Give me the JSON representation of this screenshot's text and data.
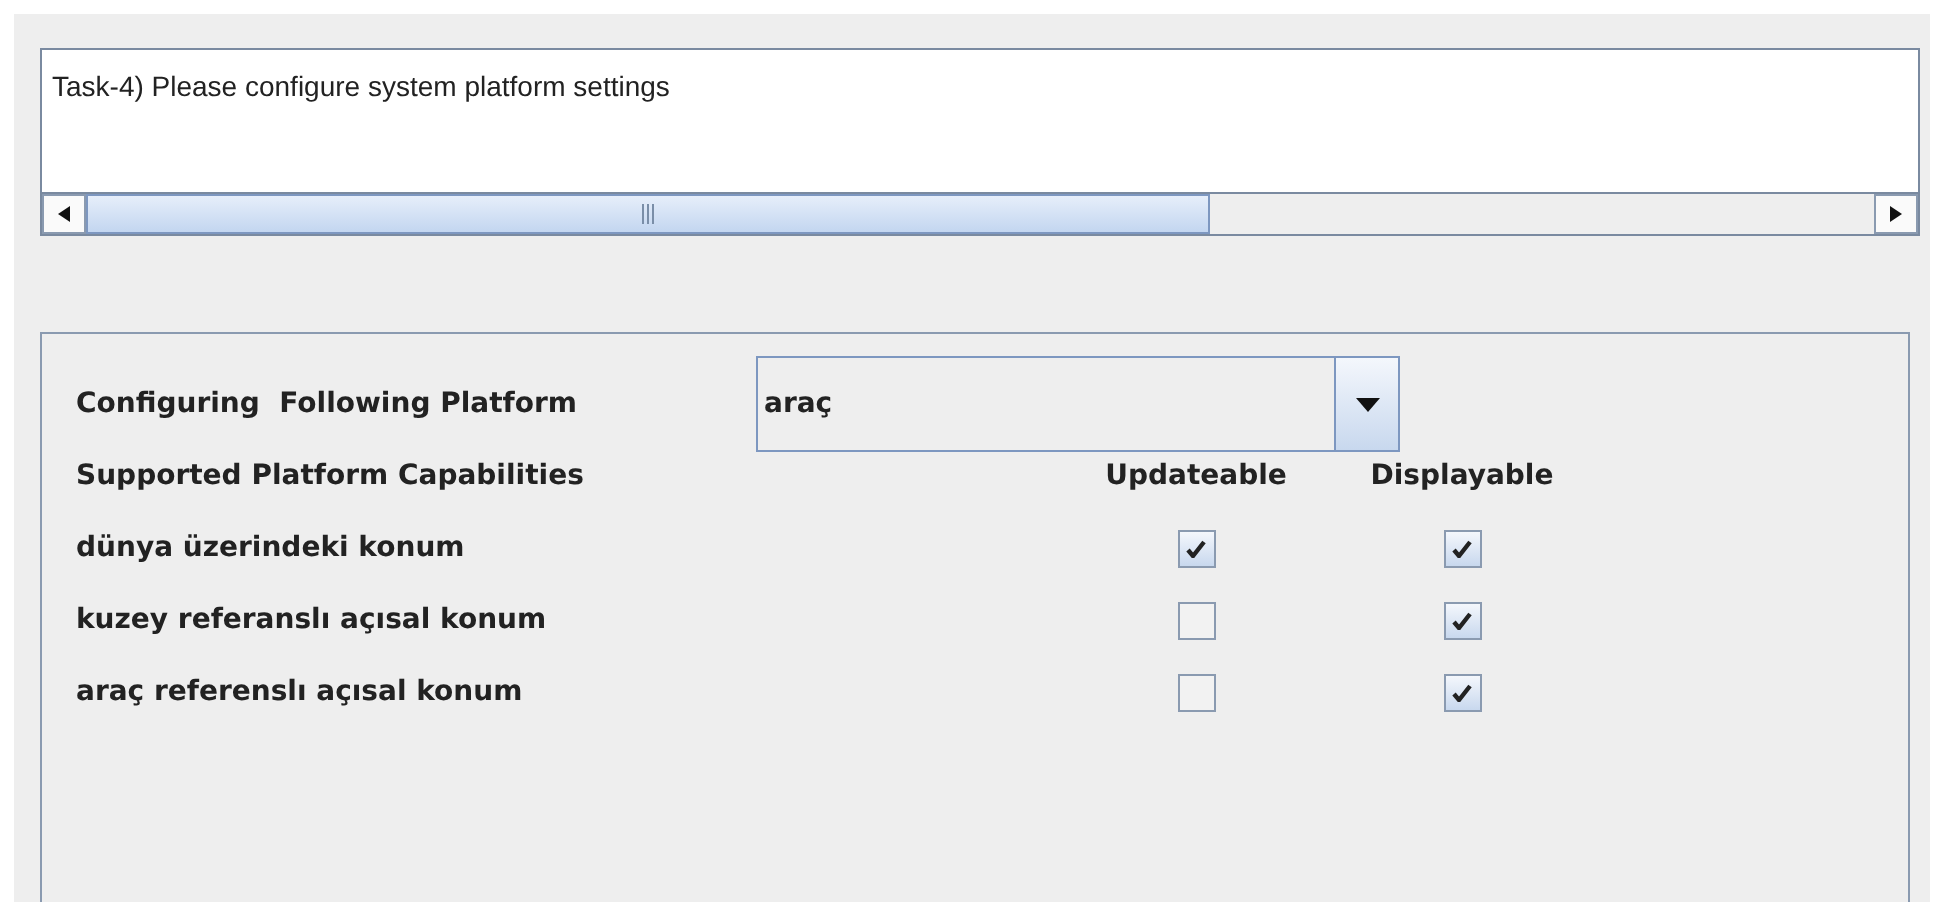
{
  "task": {
    "text": "Task-4) Please configure system platform settings"
  },
  "platform": {
    "label": "Configuring  Following Platform",
    "value": "araç"
  },
  "capabilities": {
    "heading": "Supported Platform Capabilities",
    "columns": [
      "Updateable",
      "Displayable"
    ],
    "rows": [
      {
        "name": "dünya üzerindeki konum",
        "updateable": true,
        "displayable": true
      },
      {
        "name": "kuzey referanslı açısal konum",
        "updateable": false,
        "displayable": true
      },
      {
        "name": "araç referenslı açısal konum",
        "updateable": false,
        "displayable": true
      }
    ]
  }
}
